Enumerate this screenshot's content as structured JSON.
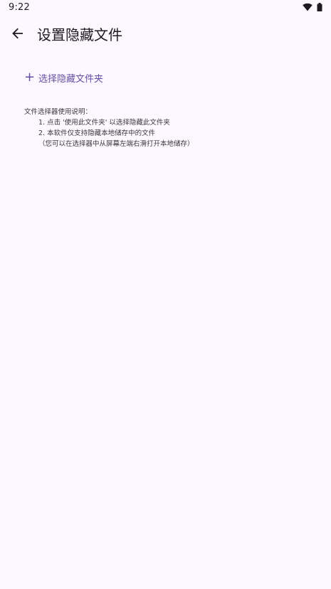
{
  "status_bar": {
    "time": "9:22",
    "wifi_icon": "wifi-icon",
    "battery_icon": "battery-icon"
  },
  "app_bar": {
    "back_icon": "arrow-back-icon",
    "title": "设置隐藏文件"
  },
  "select_folder": {
    "icon": "plus-icon",
    "icon_glyph": "+",
    "label": "选择隐藏文件夹"
  },
  "instructions": {
    "heading": "文件选择器使用说明：",
    "items": [
      "1. 点击 '使用此文件夹' 以选择隐藏此文件夹",
      "2. 本软件仅支持隐藏本地储存中的文件"
    ],
    "note": "（您可以在选择器中从屏幕左端右滑打开本地储存）"
  },
  "colors": {
    "background": "#fdf7ff",
    "accent": "#6750a4",
    "text": "#1d1b20"
  }
}
